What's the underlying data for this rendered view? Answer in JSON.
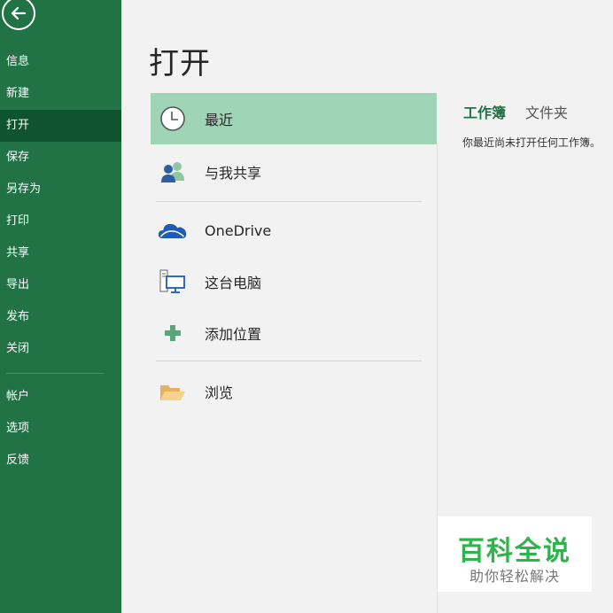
{
  "sidebar": {
    "back_icon": "back-arrow-icon",
    "items": [
      {
        "label": "信息"
      },
      {
        "label": "新建"
      },
      {
        "label": "打开",
        "active": true
      },
      {
        "label": "保存"
      },
      {
        "label": "另存为"
      },
      {
        "label": "打印"
      },
      {
        "label": "共享"
      },
      {
        "label": "导出"
      },
      {
        "label": "发布"
      },
      {
        "label": "关闭"
      },
      {
        "label": "帐户"
      },
      {
        "label": "选项"
      },
      {
        "label": "反馈"
      }
    ],
    "bg_color": "#217346",
    "active_color": "#0f542f"
  },
  "main": {
    "title": "打开",
    "locations": [
      {
        "label": "最近",
        "icon": "clock-icon",
        "selected": true
      },
      {
        "label": "与我共享",
        "icon": "shared-people-icon"
      },
      {
        "label": "OneDrive",
        "icon": "cloud-icon"
      },
      {
        "label": "这台电脑",
        "icon": "computer-icon"
      },
      {
        "label": "添加位置",
        "icon": "plus-icon"
      },
      {
        "label": "浏览",
        "icon": "folder-icon"
      }
    ],
    "selected_color": "#9fd5b7",
    "tabs": [
      {
        "label": "工作簿",
        "active": true
      },
      {
        "label": "文件夹"
      }
    ],
    "empty_message": "你最近尚未打开任何工作簿。"
  },
  "watermark": {
    "title": "百科全说",
    "subtitle": "助你轻松解决"
  }
}
